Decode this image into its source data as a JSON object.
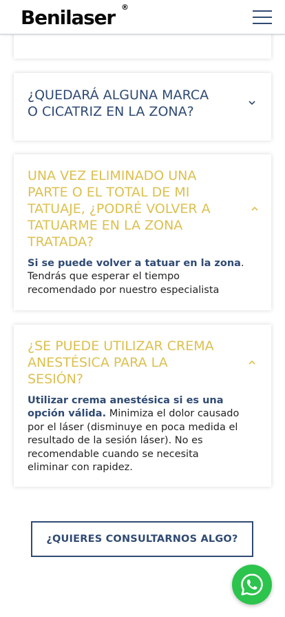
{
  "header": {
    "logo": "Benilaser",
    "logo_mark": "®",
    "menu_icon": "hamburger-menu-icon"
  },
  "faq": [
    {
      "question": "",
      "state": "open"
    },
    {
      "question": "¿QUEDARÁ ALGUNA MARCA O CICATRIZ EN LA ZONA?",
      "question_lines": [
        "¿QUEDARÁ ALGUNA MARCA",
        "O CICATRIZ EN LA ZONA?"
      ],
      "state": "closed",
      "icon": "chevron-down-icon"
    },
    {
      "question": "UNA VEZ ELIMINADO UNA PARTE O EL TOTAL DE MI TATUAJE, ¿PODRÉ VOLVER A TATUARME EN LA ZONA TRATADA?",
      "question_lines": [
        "UNA VEZ ELIMINADO UNA",
        "PARTE O EL TOTAL DE MI",
        "TATUAJE, ¿PODRÉ VOLVER A",
        "TATUARME EN LA ZONA",
        "TRATADA?"
      ],
      "state": "open",
      "icon": "chevron-up-icon",
      "answer_bold": "Si se puede volver a tatuar en la zona",
      "answer_rest": ". Tendrás que esperar el tiempo recomendado por nuestro especialista",
      "answer_lines": [
        {
          "bold": "Si se puede volver a tatuar en la zona",
          "text": "."
        },
        {
          "bold": "",
          "text": "Tendrás que esperar el tiempo"
        },
        {
          "bold": "",
          "text": "recomendado por nuestro especialista"
        }
      ]
    },
    {
      "question": "¿SE PUEDE UTILIZAR CREMA ANESTÉSICA PARA LA SESIÓN?",
      "question_lines": [
        "¿SE PUEDE UTILIZAR CREMA",
        "ANESTÉSICA PARA LA",
        "SESIÓN?"
      ],
      "state": "open",
      "icon": "chevron-up-icon",
      "answer_bold": "Utilizar crema anestésica si es una opción válida.",
      "answer_rest": " Minimiza el dolor causado por el láser (disminuye en poca medida el resultado de la sesión láser). No es recomendable cuando se necesita eliminar con rapidez.",
      "answer_lines": [
        {
          "bold": "Utilizar crema anestésica si es una",
          "text": ""
        },
        {
          "bold": "opción válida.",
          "text": " Minimiza el dolor causado"
        },
        {
          "bold": "",
          "text": "por el láser (disminuye en poca medida el"
        },
        {
          "bold": "",
          "text": "resultado de la sesión láser). No es"
        },
        {
          "bold": "",
          "text": "recomendable cuando se necesita"
        },
        {
          "bold": "",
          "text": "eliminar con rapidez."
        }
      ]
    }
  ],
  "cta": {
    "label": "¿QUIERES CONSULTARNOS ALGO?"
  },
  "whatsapp": {
    "icon": "whatsapp-icon",
    "color": "#2cc44c"
  },
  "colors": {
    "navy": "#2f4a73",
    "gold": "#dcc04f",
    "text": "#222222"
  }
}
